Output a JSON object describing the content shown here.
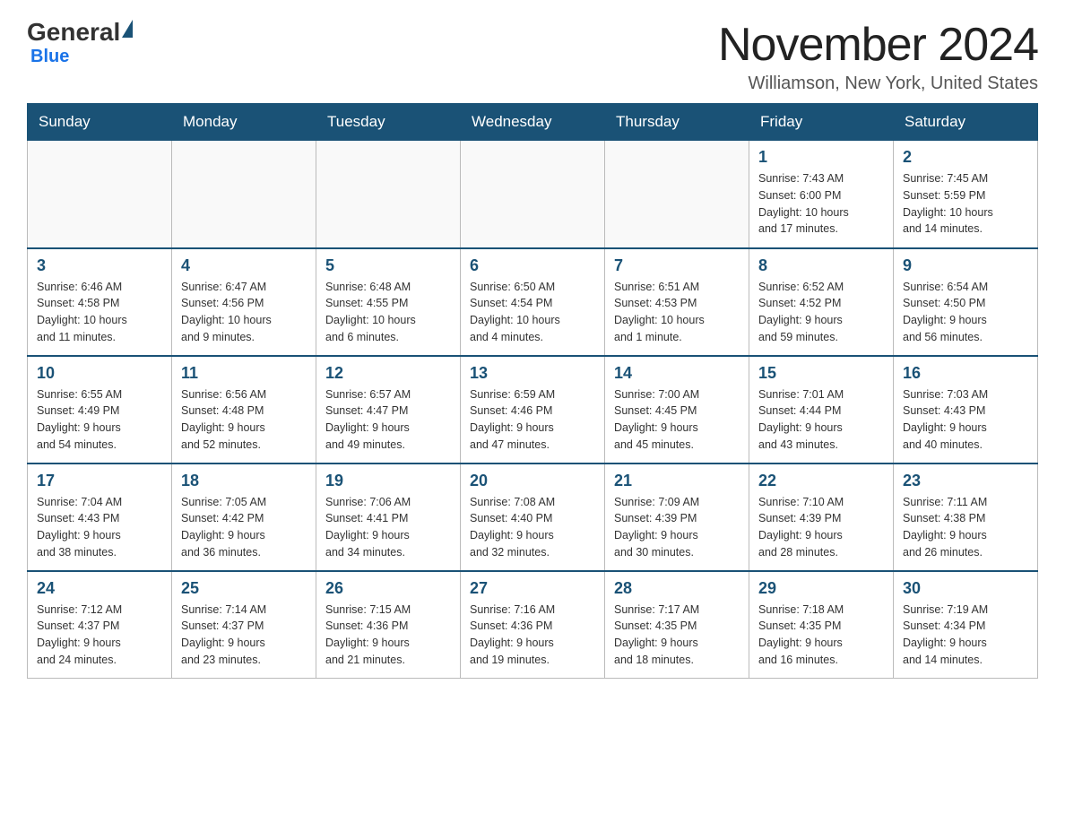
{
  "logo": {
    "general": "General",
    "blue": "Blue"
  },
  "title": "November 2024",
  "subtitle": "Williamson, New York, United States",
  "days_of_week": [
    "Sunday",
    "Monday",
    "Tuesday",
    "Wednesday",
    "Thursday",
    "Friday",
    "Saturday"
  ],
  "weeks": [
    [
      {
        "day": "",
        "info": ""
      },
      {
        "day": "",
        "info": ""
      },
      {
        "day": "",
        "info": ""
      },
      {
        "day": "",
        "info": ""
      },
      {
        "day": "",
        "info": ""
      },
      {
        "day": "1",
        "info": "Sunrise: 7:43 AM\nSunset: 6:00 PM\nDaylight: 10 hours\nand 17 minutes."
      },
      {
        "day": "2",
        "info": "Sunrise: 7:45 AM\nSunset: 5:59 PM\nDaylight: 10 hours\nand 14 minutes."
      }
    ],
    [
      {
        "day": "3",
        "info": "Sunrise: 6:46 AM\nSunset: 4:58 PM\nDaylight: 10 hours\nand 11 minutes."
      },
      {
        "day": "4",
        "info": "Sunrise: 6:47 AM\nSunset: 4:56 PM\nDaylight: 10 hours\nand 9 minutes."
      },
      {
        "day": "5",
        "info": "Sunrise: 6:48 AM\nSunset: 4:55 PM\nDaylight: 10 hours\nand 6 minutes."
      },
      {
        "day": "6",
        "info": "Sunrise: 6:50 AM\nSunset: 4:54 PM\nDaylight: 10 hours\nand 4 minutes."
      },
      {
        "day": "7",
        "info": "Sunrise: 6:51 AM\nSunset: 4:53 PM\nDaylight: 10 hours\nand 1 minute."
      },
      {
        "day": "8",
        "info": "Sunrise: 6:52 AM\nSunset: 4:52 PM\nDaylight: 9 hours\nand 59 minutes."
      },
      {
        "day": "9",
        "info": "Sunrise: 6:54 AM\nSunset: 4:50 PM\nDaylight: 9 hours\nand 56 minutes."
      }
    ],
    [
      {
        "day": "10",
        "info": "Sunrise: 6:55 AM\nSunset: 4:49 PM\nDaylight: 9 hours\nand 54 minutes."
      },
      {
        "day": "11",
        "info": "Sunrise: 6:56 AM\nSunset: 4:48 PM\nDaylight: 9 hours\nand 52 minutes."
      },
      {
        "day": "12",
        "info": "Sunrise: 6:57 AM\nSunset: 4:47 PM\nDaylight: 9 hours\nand 49 minutes."
      },
      {
        "day": "13",
        "info": "Sunrise: 6:59 AM\nSunset: 4:46 PM\nDaylight: 9 hours\nand 47 minutes."
      },
      {
        "day": "14",
        "info": "Sunrise: 7:00 AM\nSunset: 4:45 PM\nDaylight: 9 hours\nand 45 minutes."
      },
      {
        "day": "15",
        "info": "Sunrise: 7:01 AM\nSunset: 4:44 PM\nDaylight: 9 hours\nand 43 minutes."
      },
      {
        "day": "16",
        "info": "Sunrise: 7:03 AM\nSunset: 4:43 PM\nDaylight: 9 hours\nand 40 minutes."
      }
    ],
    [
      {
        "day": "17",
        "info": "Sunrise: 7:04 AM\nSunset: 4:43 PM\nDaylight: 9 hours\nand 38 minutes."
      },
      {
        "day": "18",
        "info": "Sunrise: 7:05 AM\nSunset: 4:42 PM\nDaylight: 9 hours\nand 36 minutes."
      },
      {
        "day": "19",
        "info": "Sunrise: 7:06 AM\nSunset: 4:41 PM\nDaylight: 9 hours\nand 34 minutes."
      },
      {
        "day": "20",
        "info": "Sunrise: 7:08 AM\nSunset: 4:40 PM\nDaylight: 9 hours\nand 32 minutes."
      },
      {
        "day": "21",
        "info": "Sunrise: 7:09 AM\nSunset: 4:39 PM\nDaylight: 9 hours\nand 30 minutes."
      },
      {
        "day": "22",
        "info": "Sunrise: 7:10 AM\nSunset: 4:39 PM\nDaylight: 9 hours\nand 28 minutes."
      },
      {
        "day": "23",
        "info": "Sunrise: 7:11 AM\nSunset: 4:38 PM\nDaylight: 9 hours\nand 26 minutes."
      }
    ],
    [
      {
        "day": "24",
        "info": "Sunrise: 7:12 AM\nSunset: 4:37 PM\nDaylight: 9 hours\nand 24 minutes."
      },
      {
        "day": "25",
        "info": "Sunrise: 7:14 AM\nSunset: 4:37 PM\nDaylight: 9 hours\nand 23 minutes."
      },
      {
        "day": "26",
        "info": "Sunrise: 7:15 AM\nSunset: 4:36 PM\nDaylight: 9 hours\nand 21 minutes."
      },
      {
        "day": "27",
        "info": "Sunrise: 7:16 AM\nSunset: 4:36 PM\nDaylight: 9 hours\nand 19 minutes."
      },
      {
        "day": "28",
        "info": "Sunrise: 7:17 AM\nSunset: 4:35 PM\nDaylight: 9 hours\nand 18 minutes."
      },
      {
        "day": "29",
        "info": "Sunrise: 7:18 AM\nSunset: 4:35 PM\nDaylight: 9 hours\nand 16 minutes."
      },
      {
        "day": "30",
        "info": "Sunrise: 7:19 AM\nSunset: 4:34 PM\nDaylight: 9 hours\nand 14 minutes."
      }
    ]
  ]
}
